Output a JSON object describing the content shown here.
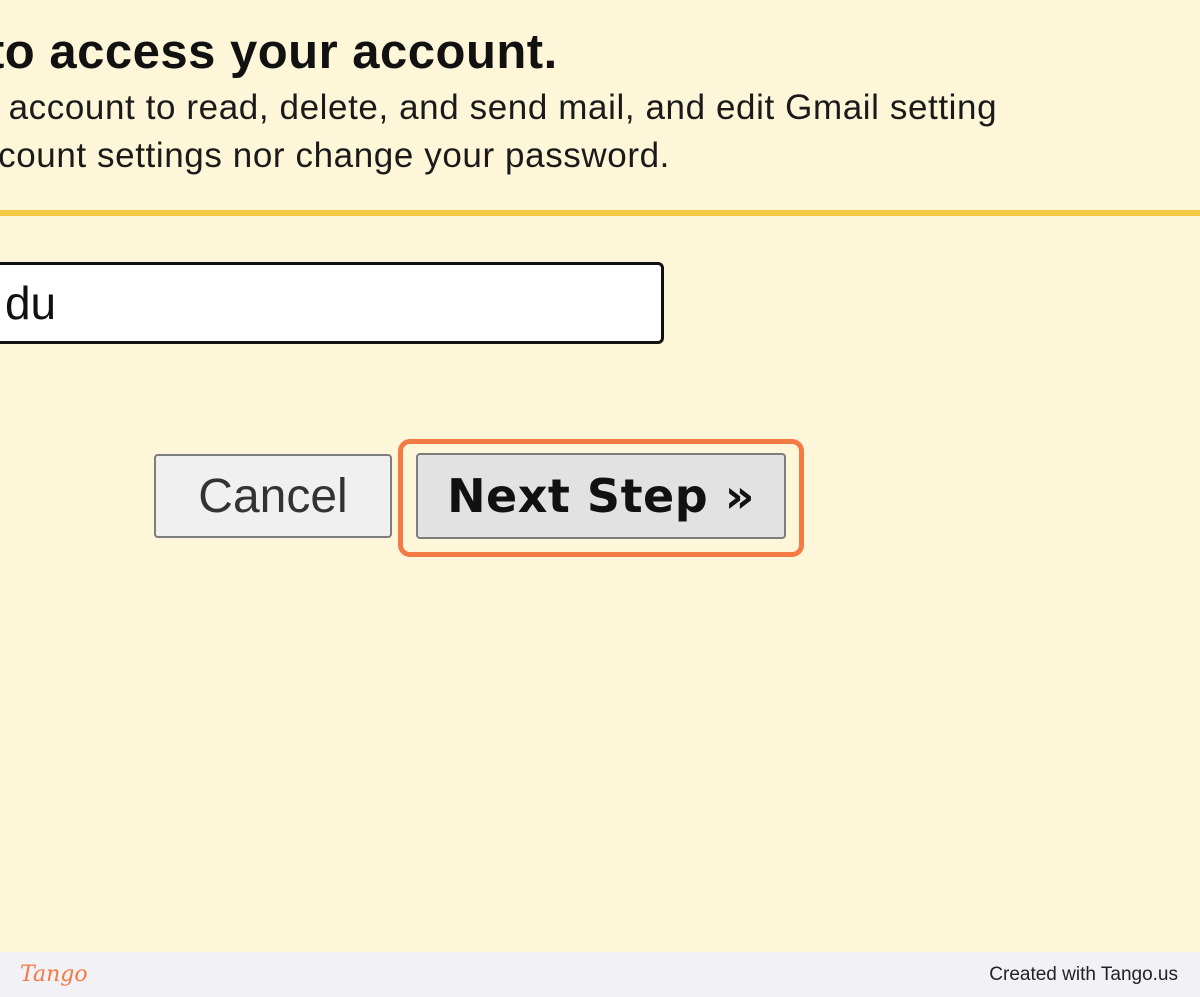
{
  "dialog": {
    "heading": "lder to access your account.",
    "description_line1": "r account to read, delete, and send mail, and edit Gmail setting",
    "description_line2": "ccount settings nor change your password.",
    "email_value": "e.edu",
    "cancel_label": "Cancel",
    "next_label": "Next Step »"
  },
  "footer": {
    "logo_text": "Tango",
    "credit_text": "Created with Tango.us"
  },
  "colors": {
    "background": "#fef6d8",
    "rule": "#f6c843",
    "highlight": "#f47a44",
    "footer_bg": "#f2f1f6"
  }
}
